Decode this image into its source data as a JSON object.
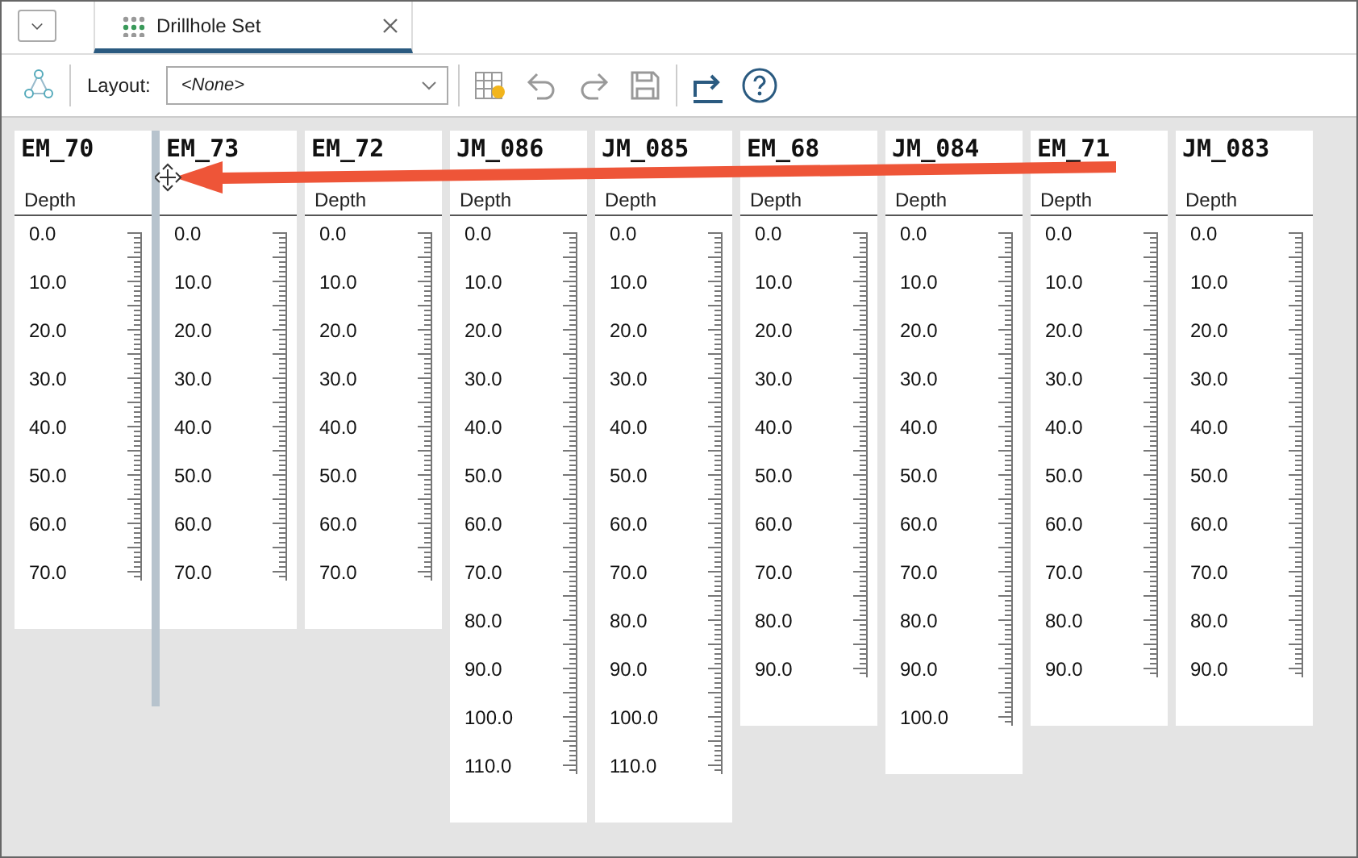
{
  "tab": {
    "title": "Drillhole Set",
    "selected": true
  },
  "toolbar": {
    "layout_label": "Layout:",
    "layout_value": "<None>"
  },
  "columns": [
    {
      "name": "EM_70",
      "depth_label": "Depth",
      "depths": [
        "0.0",
        "10.0",
        "20.0",
        "30.0",
        "40.0",
        "50.0",
        "60.0",
        "70.0"
      ]
    },
    {
      "name": "EM_73",
      "depths": [
        "0.0",
        "10.0",
        "20.0",
        "30.0",
        "40.0",
        "50.0",
        "60.0",
        "70.0"
      ]
    },
    {
      "name": "EM_72",
      "depth_label": "Depth",
      "depths": [
        "0.0",
        "10.0",
        "20.0",
        "30.0",
        "40.0",
        "50.0",
        "60.0",
        "70.0"
      ]
    },
    {
      "name": "JM_086",
      "depth_label": "Depth",
      "depths": [
        "0.0",
        "10.0",
        "20.0",
        "30.0",
        "40.0",
        "50.0",
        "60.0",
        "70.0",
        "80.0",
        "90.0",
        "100.0",
        "110.0"
      ]
    },
    {
      "name": "JM_085",
      "depth_label": "Depth",
      "depths": [
        "0.0",
        "10.0",
        "20.0",
        "30.0",
        "40.0",
        "50.0",
        "60.0",
        "70.0",
        "80.0",
        "90.0",
        "100.0",
        "110.0"
      ]
    },
    {
      "name": "EM_68",
      "depth_label": "Depth",
      "depths": [
        "0.0",
        "10.0",
        "20.0",
        "30.0",
        "40.0",
        "50.0",
        "60.0",
        "70.0",
        "80.0",
        "90.0"
      ]
    },
    {
      "name": "JM_084",
      "depth_label": "Depth",
      "depths": [
        "0.0",
        "10.0",
        "20.0",
        "30.0",
        "40.0",
        "50.0",
        "60.0",
        "70.0",
        "80.0",
        "90.0",
        "100.0"
      ]
    },
    {
      "name": "EM_71",
      "depth_label": "Depth",
      "depths": [
        "0.0",
        "10.0",
        "20.0",
        "30.0",
        "40.0",
        "50.0",
        "60.0",
        "70.0",
        "80.0",
        "90.0"
      ]
    },
    {
      "name": "JM_083",
      "depth_label": "Depth",
      "depths": [
        "0.0",
        "10.0",
        "20.0",
        "30.0",
        "40.0",
        "50.0",
        "60.0",
        "70.0",
        "80.0",
        "90.0"
      ]
    }
  ]
}
